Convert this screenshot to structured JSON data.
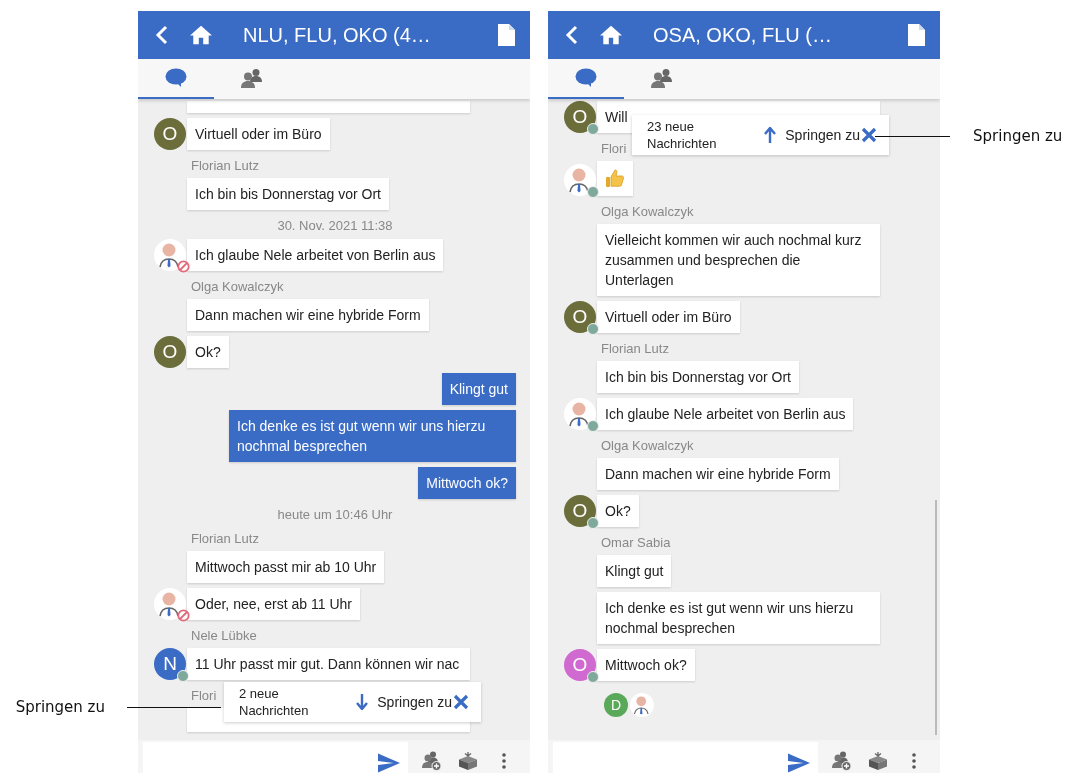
{
  "phones": [
    {
      "title": "NLU, FLU, OKO (4…",
      "tabs": [
        {
          "kind": "chat",
          "selected": true
        },
        {
          "kind": "people",
          "selected": false
        }
      ],
      "messages": [
        {
          "kind": "fragment"
        },
        {
          "kind": "incoming",
          "text": "Virtuell oder im Büro",
          "avatar": {
            "kind": "letter",
            "letter": "O",
            "color": "#6b6d3a",
            "online": false
          }
        },
        {
          "kind": "sender",
          "text": "Florian Lutz"
        },
        {
          "kind": "incoming",
          "text": "Ich bin bis Donnerstag vor Ort"
        },
        {
          "kind": "date",
          "text": "30. Nov. 2021 11:38"
        },
        {
          "kind": "incoming",
          "text": "Ich glaube Nele arbeitet von Berlin aus",
          "avatar": {
            "kind": "person",
            "online": false,
            "blocked": true
          }
        },
        {
          "kind": "sender",
          "text": "Olga Kowalczyk"
        },
        {
          "kind": "incoming",
          "text": "Dann machen wir eine hybride Form"
        },
        {
          "kind": "incoming",
          "text": "Ok?",
          "avatar": {
            "kind": "letter",
            "letter": "O",
            "color": "#6b6d3a",
            "online": false
          }
        },
        {
          "kind": "outgoing",
          "text": "Klingt gut"
        },
        {
          "kind": "outgoing",
          "text": "Ich denke es ist gut wenn wir uns hierzu nochmal besprechen"
        },
        {
          "kind": "outgoing",
          "text": "Mittwoch ok?"
        },
        {
          "kind": "date",
          "text": "heute um 10:46 Uhr"
        },
        {
          "kind": "sender",
          "text": "Florian Lutz"
        },
        {
          "kind": "incoming",
          "text": "Mittwoch passt mir ab 10 Uhr"
        },
        {
          "kind": "incoming",
          "text": "Oder, nee, erst ab 11 Uhr",
          "avatar": {
            "kind": "person",
            "online": false,
            "blocked": true
          }
        },
        {
          "kind": "sender",
          "text": "Nele Lübke"
        },
        {
          "kind": "incoming",
          "text": "11 Uhr passt mir gut. Dann können wir nac",
          "obscured": true,
          "avatar": {
            "kind": "letter",
            "letter": "N",
            "color": "#3a6bc5",
            "online": true
          }
        },
        {
          "kind": "sender",
          "text": "Flori"
        },
        {
          "kind": "fragment"
        }
      ],
      "new_messages": {
        "kind": "down",
        "text": "2 neue Nachrichten",
        "link": "Springen zu"
      },
      "annotation": {
        "kind": "left",
        "text": "Springen zu"
      }
    },
    {
      "title": "OSA, OKO, FLU (…",
      "tabs": [
        {
          "kind": "chat",
          "selected": true
        },
        {
          "kind": "people",
          "selected": false
        }
      ],
      "messages": [
        {
          "kind": "incoming",
          "text": "Will",
          "obscured": true,
          "avatar": {
            "kind": "letter",
            "letter": "O",
            "color": "#6b6d3a",
            "online": true
          }
        },
        {
          "kind": "sender",
          "text": "Flori"
        },
        {
          "kind": "thumbs_up",
          "avatar": {
            "kind": "person",
            "online": true,
            "blocked": false
          }
        },
        {
          "kind": "sender",
          "text": "Olga Kowalczyk"
        },
        {
          "kind": "incoming",
          "text": "Vielleicht kommen wir auch nochmal kurz zusammen und besprechen die Unterlagen"
        },
        {
          "kind": "incoming",
          "text": "Virtuell oder im Büro",
          "avatar": {
            "kind": "letter",
            "letter": "O",
            "color": "#6b6d3a",
            "online": true
          }
        },
        {
          "kind": "sender",
          "text": "Florian Lutz"
        },
        {
          "kind": "incoming",
          "text": "Ich bin bis Donnerstag vor Ort"
        },
        {
          "kind": "incoming",
          "text": "Ich glaube Nele arbeitet von Berlin aus",
          "avatar": {
            "kind": "person",
            "online": true,
            "blocked": false
          }
        },
        {
          "kind": "sender",
          "text": "Olga Kowalczyk"
        },
        {
          "kind": "incoming",
          "text": "Dann machen wir eine hybride Form"
        },
        {
          "kind": "incoming",
          "text": "Ok?",
          "avatar": {
            "kind": "letter",
            "letter": "O",
            "color": "#6b6d3a",
            "online": true
          }
        },
        {
          "kind": "sender",
          "text": "Omar Sabia"
        },
        {
          "kind": "incoming",
          "text": "Klingt gut"
        },
        {
          "kind": "incoming",
          "text": "Ich denke es ist gut wenn wir uns hierzu nochmal besprechen"
        },
        {
          "kind": "incoming",
          "text": "Mittwoch ok?",
          "avatar": {
            "kind": "letter",
            "letter": "O",
            "color": "#d06ad0",
            "online": true
          }
        },
        {
          "kind": "readers",
          "readers": [
            {
              "kind": "letter",
              "letter": "D",
              "color": "#5aa85a"
            },
            {
              "kind": "person"
            }
          ]
        }
      ],
      "new_messages": {
        "kind": "up",
        "text": "23 neue Nachrichten",
        "link": "Springen zu"
      },
      "annotation": {
        "kind": "right",
        "text": "Springen zu"
      },
      "scrollbar": true
    }
  ]
}
